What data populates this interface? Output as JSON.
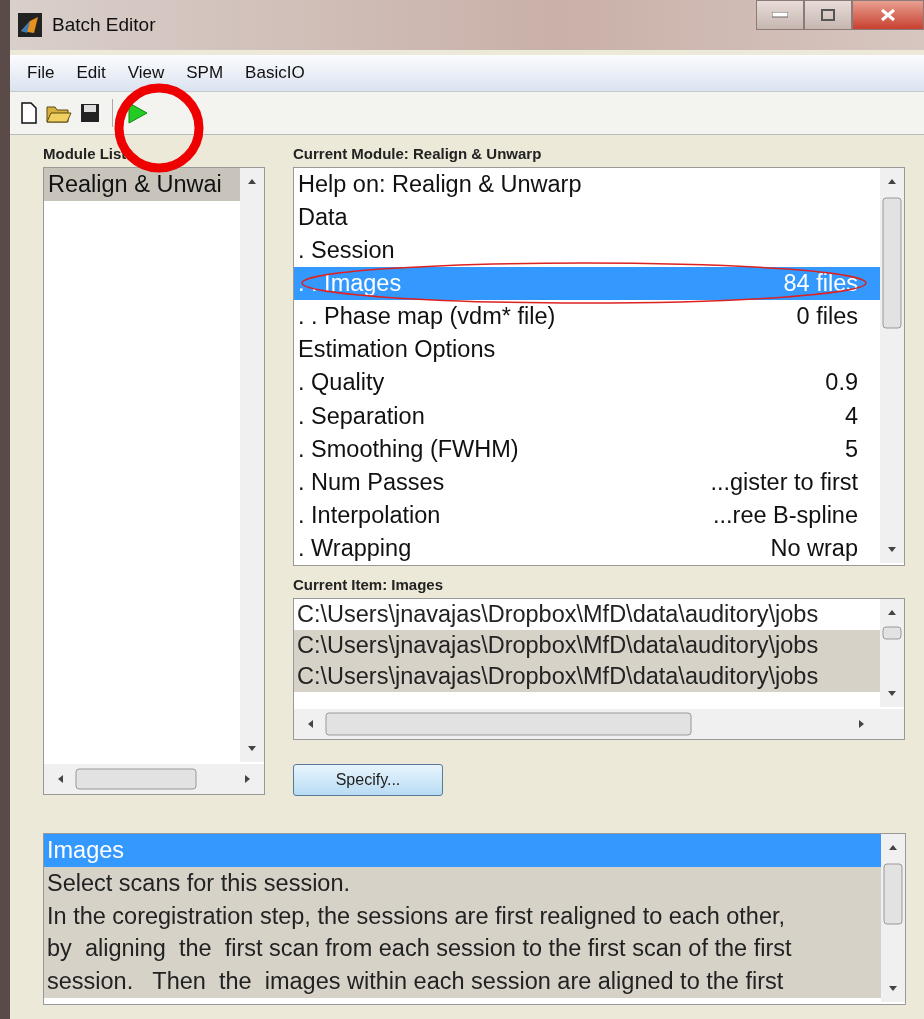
{
  "window": {
    "title": "Batch Editor"
  },
  "menu": [
    "File",
    "Edit",
    "View",
    "SPM",
    "BasicIO"
  ],
  "module_list": {
    "label": "Module List",
    "items": [
      {
        "text": "Realign & Unwai",
        "selected": true
      }
    ]
  },
  "current_module": {
    "label": "Current Module: Realign & Unwarp",
    "rows": [
      {
        "text": "Help on: Realign & Unwarp",
        "value": "",
        "selected": false
      },
      {
        "text": "Data",
        "value": "",
        "selected": false
      },
      {
        "text": ". Session",
        "value": "",
        "selected": false
      },
      {
        "text": ". . Images",
        "value": "84 files",
        "selected": true
      },
      {
        "text": ". . Phase map (vdm* file)",
        "value": "0 files",
        "selected": false
      },
      {
        "text": "Estimation Options",
        "value": "",
        "selected": false
      },
      {
        "text": ". Quality",
        "value": "0.9",
        "selected": false
      },
      {
        "text": ". Separation",
        "value": "4",
        "selected": false
      },
      {
        "text": ". Smoothing (FWHM)",
        "value": "5",
        "selected": false
      },
      {
        "text": ". Num Passes",
        "value": "...gister to first",
        "selected": false
      },
      {
        "text": ". Interpolation",
        "value": "...ree B-spline",
        "selected": false
      },
      {
        "text": ". Wrapping",
        "value": "No wrap",
        "selected": false
      }
    ]
  },
  "current_item": {
    "label": "Current Item: Images",
    "rows": [
      {
        "text": "C:\\Users\\jnavajas\\Dropbox\\MfD\\data\\auditory\\jobs",
        "selected": false
      },
      {
        "text": "C:\\Users\\jnavajas\\Dropbox\\MfD\\data\\auditory\\jobs",
        "selected": true
      },
      {
        "text": "C:\\Users\\jnavajas\\Dropbox\\MfD\\data\\auditory\\jobs",
        "selected": true
      }
    ]
  },
  "specify_button": "Specify...",
  "help": {
    "title": "Images",
    "lines": [
      "Select scans for this session.",
      "In the coregistration step, the sessions are first realigned to each other,",
      "by  aligning  the  first scan from each session to the first scan of the first",
      "session.   Then  the  images within each session are aligned to the first"
    ]
  }
}
